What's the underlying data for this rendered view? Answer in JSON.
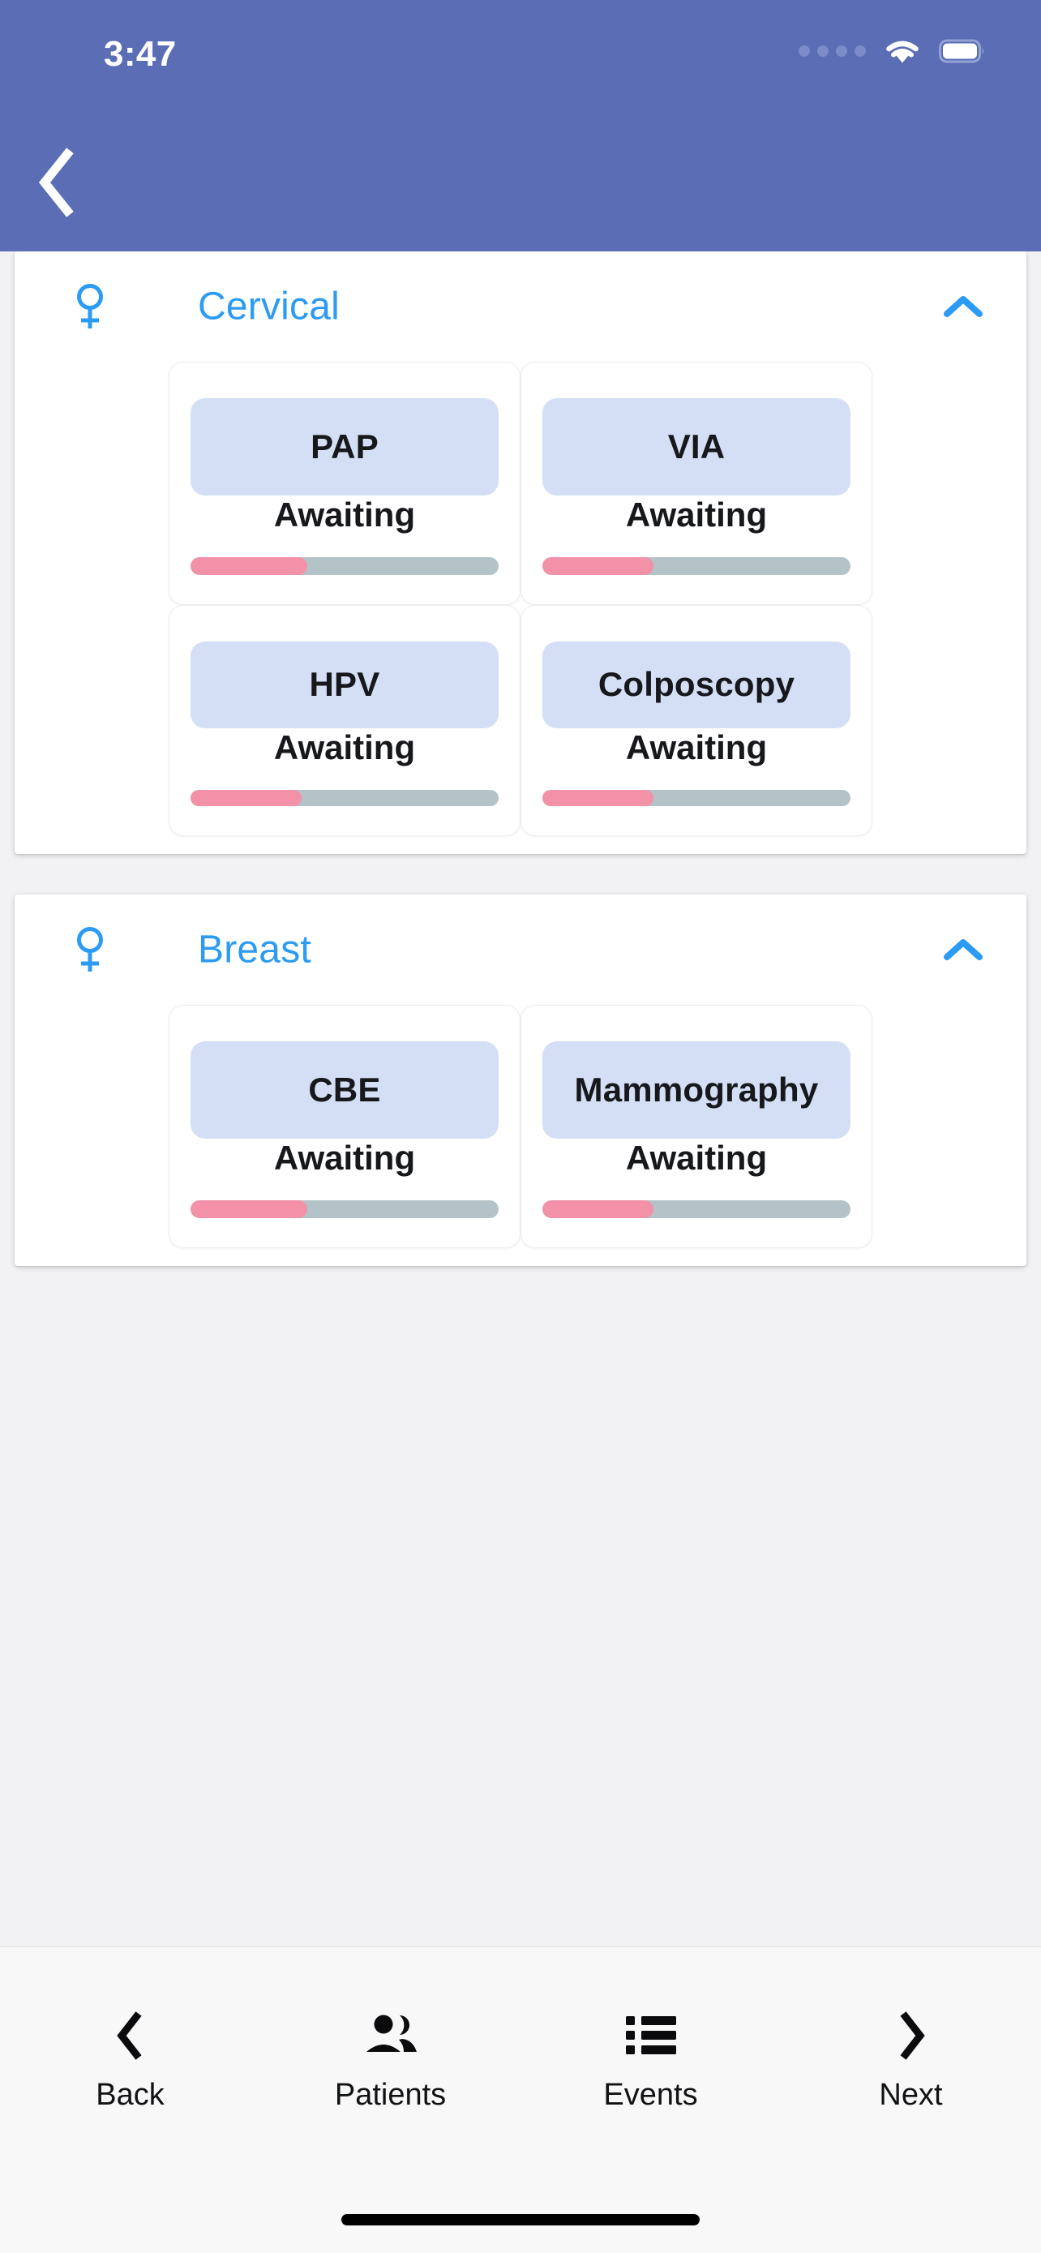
{
  "status_bar": {
    "time": "3:47",
    "cellular_icon": "cellular-dots-icon",
    "wifi_icon": "wifi-icon",
    "battery_icon": "battery-full-icon"
  },
  "app_bar": {
    "background_color": "#5a6db5",
    "back_icon": "chevron-left-icon"
  },
  "theme": {
    "accent_blue": "#2b9bf4",
    "pill_blue": "#d4dff5",
    "progress_fill": "#f291a8",
    "progress_track": "#b4c3c7",
    "page_background": "#f2f2f4"
  },
  "sections": [
    {
      "id": "cervical",
      "title": "Cervical",
      "gender_icon": "female-venus-icon",
      "collapse_icon": "chevron-up-icon",
      "expanded": true,
      "tests": [
        {
          "name": "PAP",
          "status": "Awaiting",
          "progress": 38
        },
        {
          "name": "VIA",
          "status": "Awaiting",
          "progress": 36
        },
        {
          "name": "HPV",
          "status": "Awaiting",
          "progress": 36
        },
        {
          "name": "Colposcopy",
          "status": "Awaiting",
          "progress": 36
        }
      ]
    },
    {
      "id": "breast",
      "title": "Breast",
      "gender_icon": "female-venus-icon",
      "collapse_icon": "chevron-up-icon",
      "expanded": true,
      "tests": [
        {
          "name": "CBE",
          "status": "Awaiting",
          "progress": 38
        },
        {
          "name": "Mammography",
          "status": "Awaiting",
          "progress": 36
        }
      ]
    }
  ],
  "bottom_nav": {
    "items": [
      {
        "label": "Back",
        "icon": "chevron-left-icon"
      },
      {
        "label": "Patients",
        "icon": "people-group-icon"
      },
      {
        "label": "Events",
        "icon": "list-bullet-icon"
      },
      {
        "label": "Next",
        "icon": "chevron-right-icon"
      }
    ]
  }
}
